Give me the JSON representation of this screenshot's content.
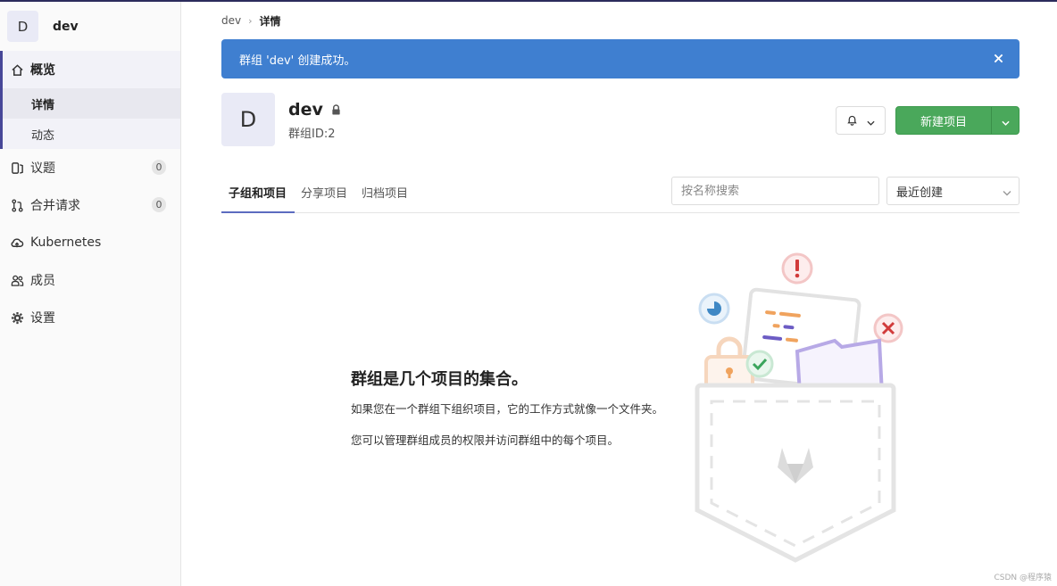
{
  "sidebar": {
    "context_avatar": "D",
    "context_name": "dev",
    "overview": {
      "label": "概览",
      "icon": "home-icon"
    },
    "sub_items": [
      {
        "label": "详情"
      },
      {
        "label": "动态"
      }
    ],
    "items": [
      {
        "label": "议题",
        "icon": "issues-icon",
        "count": "0"
      },
      {
        "label": "合并请求",
        "icon": "merge-request-icon",
        "count": "0"
      },
      {
        "label": "Kubernetes",
        "icon": "cloud-icon"
      },
      {
        "label": "成员",
        "icon": "users-icon"
      },
      {
        "label": "设置",
        "icon": "gear-icon"
      }
    ]
  },
  "breadcrumb": {
    "parent": "dev",
    "current": "详情"
  },
  "flash": {
    "message": "群组 'dev' 创建成功。"
  },
  "group": {
    "avatar": "D",
    "name": "dev",
    "id_text": "群组ID:2"
  },
  "actions": {
    "new_project": "新建项目"
  },
  "tabs": [
    {
      "label": "子组和项目"
    },
    {
      "label": "分享项目"
    },
    {
      "label": "归档项目"
    }
  ],
  "filter": {
    "search_placeholder": "按名称搜索",
    "sort_selected": "最近创建"
  },
  "empty_state": {
    "title": "群组是几个项目的集合。",
    "line1": "如果您在一个群组下组织项目，它的工作方式就像一个文件夹。",
    "line2": "您可以管理群组成员的权限并访问群组中的每个项目。"
  },
  "watermark": "CSDN @程序猿",
  "colors": {
    "flash": "#3f7fd0",
    "primary_button": "#4aa85b",
    "active_tab": "#5c6bc0"
  }
}
